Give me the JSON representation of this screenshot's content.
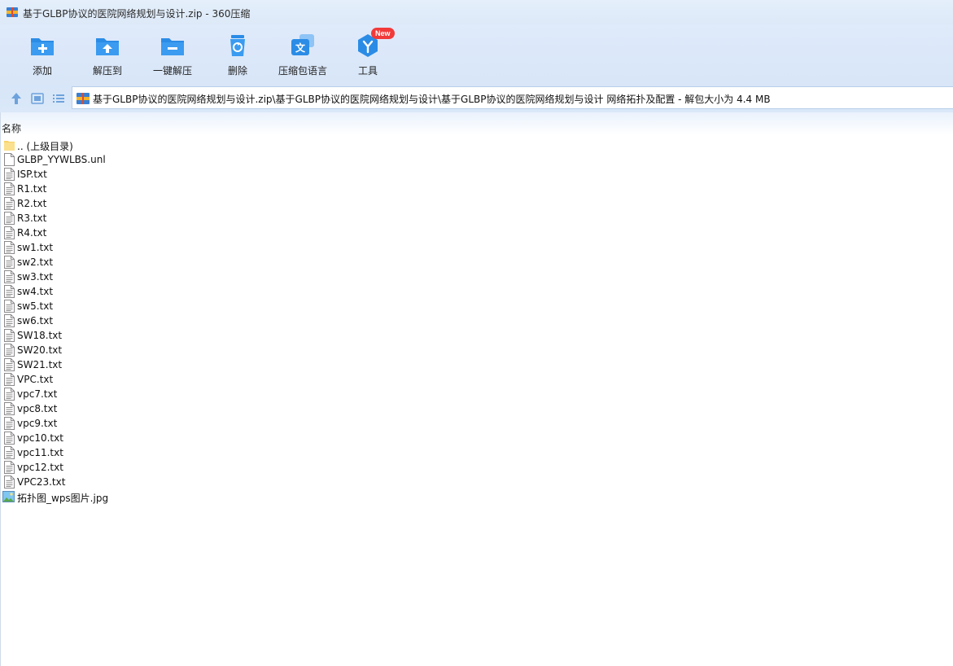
{
  "window": {
    "title": "基于GLBP协议的医院网络规划与设计.zip - 360压缩"
  },
  "toolbar": {
    "items": [
      {
        "label": "添加",
        "icon": "add-folder-icon"
      },
      {
        "label": "解压到",
        "icon": "extract-to-icon"
      },
      {
        "label": "一键解压",
        "icon": "one-click-extract-icon"
      },
      {
        "label": "删除",
        "icon": "delete-icon"
      },
      {
        "label": "压缩包语言",
        "icon": "archive-language-icon"
      },
      {
        "label": "工具",
        "icon": "tools-icon",
        "badge": "New"
      }
    ]
  },
  "pathbar": {
    "path": "基于GLBP协议的医院网络规划与设计.zip\\基于GLBP协议的医院网络规划与设计\\基于GLBP协议的医院网络规划与设计 网络拓扑及配置 - 解包大小为 4.4 MB"
  },
  "columns": {
    "name": "名称"
  },
  "files": [
    {
      "name": ".. (上级目录)",
      "type": "folder"
    },
    {
      "name": "GLBP_YYWLBS.unl",
      "type": "blank"
    },
    {
      "name": "ISP.txt",
      "type": "text"
    },
    {
      "name": "R1.txt",
      "type": "text"
    },
    {
      "name": "R2.txt",
      "type": "text"
    },
    {
      "name": "R3.txt",
      "type": "text"
    },
    {
      "name": "R4.txt",
      "type": "text"
    },
    {
      "name": "sw1.txt",
      "type": "text"
    },
    {
      "name": "sw2.txt",
      "type": "text"
    },
    {
      "name": "sw3.txt",
      "type": "text"
    },
    {
      "name": "sw4.txt",
      "type": "text"
    },
    {
      "name": "sw5.txt",
      "type": "text"
    },
    {
      "name": "sw6.txt",
      "type": "text"
    },
    {
      "name": "SW18.txt",
      "type": "text"
    },
    {
      "name": "SW20.txt",
      "type": "text"
    },
    {
      "name": "SW21.txt",
      "type": "text"
    },
    {
      "name": "VPC.txt",
      "type": "text"
    },
    {
      "name": "vpc7.txt",
      "type": "text"
    },
    {
      "name": "vpc8.txt",
      "type": "text"
    },
    {
      "name": "vpc9.txt",
      "type": "text"
    },
    {
      "name": "vpc10.txt",
      "type": "text"
    },
    {
      "name": "vpc11.txt",
      "type": "text"
    },
    {
      "name": "vpc12.txt",
      "type": "text"
    },
    {
      "name": "VPC23.txt",
      "type": "text"
    },
    {
      "name": "拓扑图_wps图片.jpg",
      "type": "image"
    }
  ],
  "colors": {
    "accent": "#2b8ce6",
    "badge": "#f23a3a",
    "folder": "#f7d468"
  }
}
